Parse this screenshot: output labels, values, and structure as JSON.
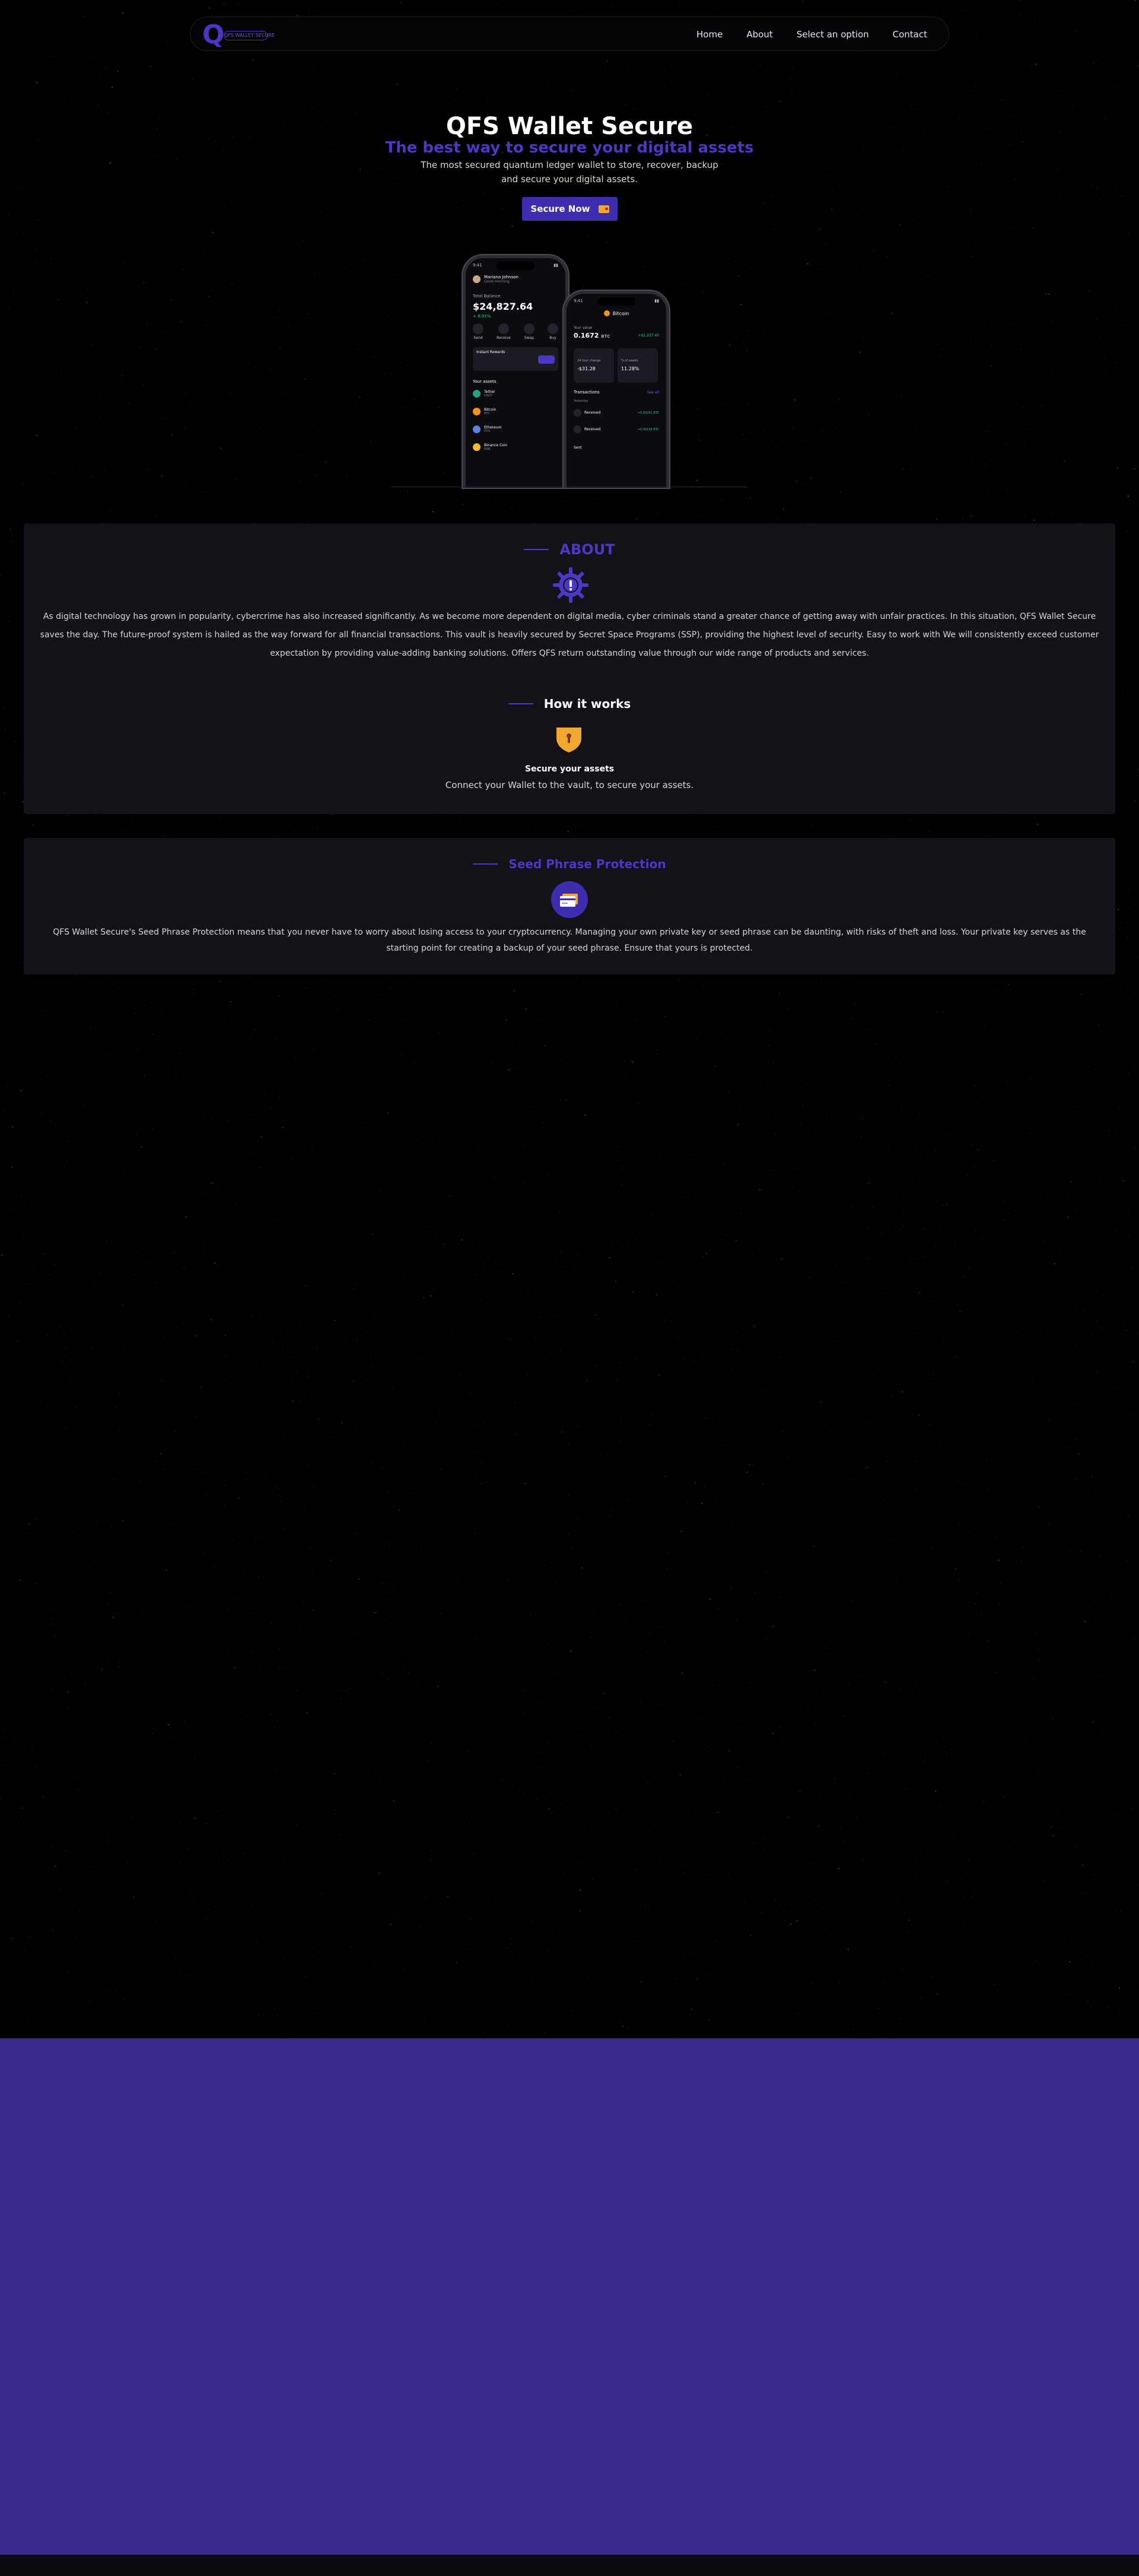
{
  "brand": {
    "logo_letter": "Q",
    "logo_text": "QFS WALLET SECURE",
    "accent": "#4b38c4",
    "footer_color": "#3a2a8e"
  },
  "nav": {
    "links": [
      "Home",
      "About",
      "Select an option",
      "Contact"
    ]
  },
  "hero": {
    "title": "QFS Wallet Secure",
    "subtitle": "The best way to secure your digital assets",
    "description": "The most secured quantum ledger wallet to store, recover, backup and secure your digital assets.",
    "cta_label": "Secure Now",
    "cta_icon": "wallet-icon"
  },
  "phone_back": {
    "time": "9:41",
    "user": "Mariana Johnson",
    "user_sub": "Good morning",
    "balance_label": "Total Balance",
    "balance": "$24,827.64",
    "change": "+ 8.91%",
    "actions": [
      "Send",
      "Receive",
      "Swap",
      "Buy"
    ],
    "promo": "Instant Rewards",
    "assets_label": "Your assets",
    "assets": [
      {
        "name": "Tether",
        "sub": "USDT",
        "color": "#26a17b"
      },
      {
        "name": "Bitcoin",
        "sub": "BTC",
        "color": "#f7931a"
      },
      {
        "name": "Ethereum",
        "sub": "ETH",
        "color": "#627eea"
      },
      {
        "name": "Binance Coin",
        "sub": "BNB",
        "color": "#f3ba2f"
      }
    ]
  },
  "phone_front": {
    "time": "9:41",
    "coin": "Bitcoin",
    "value_label": "Your value",
    "value": "0.1672",
    "value_unit": "BTC",
    "value_usd": "+$1,237.40",
    "stat1_label": "24 hour change",
    "stat1_value": "-$31.28",
    "stat2_label": "% of assets",
    "stat2_value": "11.28%",
    "tx_label": "Transactions",
    "tx_link": "See all",
    "tx_date": "Yesterday",
    "transactions": [
      {
        "name": "Received",
        "amount": "+0.00241 BTC"
      },
      {
        "name": "Received",
        "amount": "+0.00156 BTC"
      }
    ],
    "bottom": "Sent"
  },
  "about": {
    "title": "ABOUT",
    "icon": "gear-icon",
    "text": "As digital technology has grown in popularity, cybercrime has also increased significantly. As we become more dependent on digital media, cyber criminals stand a greater chance of getting away with unfair practices. In this situation, QFS Wallet Secure saves the day. The future-proof system is hailed as the way forward for all financial transactions. This vault is heavily secured by Secret Space Programs (SSP), providing the highest level of security. Easy to work with We will consistently exceed customer expectation by providing value-adding banking solutions. Offers QFS return outstanding value through our wide range of products and services.",
    "how_title": "How it works",
    "how_icon": "shield-icon",
    "step_title": "Secure your assets",
    "step_text": "Connect your Wallet to the vault, to secure your assets."
  },
  "seed": {
    "title": "Seed Phrase Protection",
    "icon": "card-icon",
    "text": "QFS Wallet Secure's Seed Phrase Protection means that you never have to worry about losing access to your cryptocurrency. Managing your own private key or seed phrase can be daunting, with risks of theft and loss. Your private key serves as the starting point for creating a backup of your seed phrase. Ensure that yours is protected."
  }
}
